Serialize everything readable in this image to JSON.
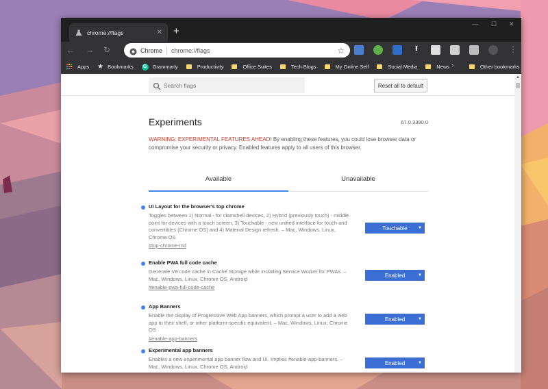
{
  "tab": {
    "title": "chrome://flags"
  },
  "omnibox": {
    "site_label": "Chrome",
    "url": "chrome://flags"
  },
  "bookmarks": {
    "items": [
      {
        "label": "Apps"
      },
      {
        "label": "Bookmarks"
      },
      {
        "label": "Grammarly"
      },
      {
        "label": "Productivity"
      },
      {
        "label": "Office Suites"
      },
      {
        "label": "Tech Blogs"
      },
      {
        "label": "My Online Self"
      },
      {
        "label": "Social Media"
      },
      {
        "label": "News"
      }
    ],
    "other": "Other bookmarks"
  },
  "search": {
    "placeholder": "Search flags"
  },
  "reset_label": "Reset all to default",
  "experiments": {
    "title": "Experiments",
    "version": "67.0.3390.0",
    "warning_red": "WARNING: EXPERIMENTAL FEATURES AHEAD!",
    "warning_rest": " By enabling these features, you could lose browser data or compromise your security or privacy. Enabled features apply to all users of this browser."
  },
  "tabs": {
    "available": "Available",
    "unavailable": "Unavailable"
  },
  "flags": [
    {
      "name": "UI Layout for the browser's top chrome",
      "desc": "Toggles between 1) Normal - for clamshell devices, 2) Hybrid (previously touch) - middle point for devices with a touch screen, 3) Touchable - new unified interface for touch and convertibles (Chrome OS) and 4) Material Design refresh. – Mac, Windows, Linux, Chrome OS",
      "link": "#top-chrome-md",
      "value": "Touchable"
    },
    {
      "name": "Enable PWA full code cache",
      "desc": "Generate V8 code cache in Cache Storage while installing Service Worker for PWAs. – Mac, Windows, Linux, Chrome OS, Android",
      "link": "#enable-pwa-full-code-cache",
      "value": "Enabled"
    },
    {
      "name": "App Banners",
      "desc": "Enable the display of Progressive Web App banners, which prompt a user to add a web app to their shelf, or other platform-specific equivalent. – Mac, Windows, Linux, Chrome OS",
      "link": "#enable-app-banners",
      "value": "Enabled"
    },
    {
      "name": "Experimental app banners",
      "desc": "Enables a new experimental app banner flow and UI. Implies #enable-app-banners. – Mac, Windows, Linux, Chrome OS, Android",
      "link": "",
      "value": "Enabled"
    }
  ]
}
